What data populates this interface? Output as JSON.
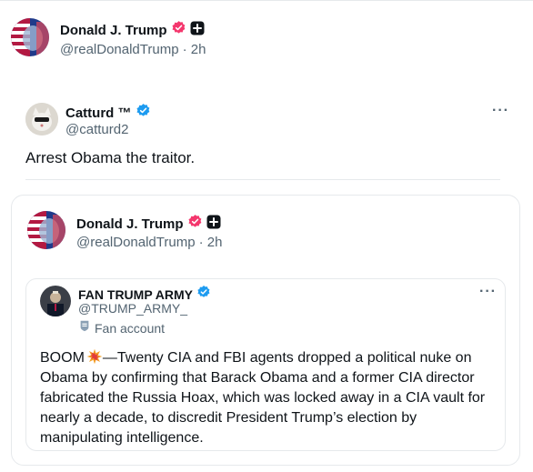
{
  "post": {
    "author_name": "Donald J. Trump",
    "author_handle": "@realDonaldTrump",
    "time": "· 2h"
  },
  "quoted_tweet": {
    "author_name": "Catturd ™",
    "author_handle": "@catturd2",
    "text": "Arrest Obama the traitor.",
    "more_label": "···"
  },
  "nested_quote": {
    "author_name": "Donald J. Trump",
    "author_handle": "@realDonaldTrump",
    "time": "· 2h",
    "inner": {
      "author_name": "FAN TRUMP ARMY",
      "author_handle": "@TRUMP_ARMY_",
      "label": "Fan account",
      "more_label": "···",
      "text_prefix": "BOOM",
      "text": "—Twenty CIA and FBI agents dropped a political nuke on Obama by confirming that Barack Obama and a former CIA director fabricated the Russia Hoax, which was locked away in a CIA vault for nearly a decade, to discredit President Trump’s election by manipulating intelligence."
    }
  },
  "colors": {
    "verified_blue": "#1d9bf0",
    "affiliation_pink": "#f4376d",
    "text_secondary": "#536471",
    "border": "#e6e9ec"
  },
  "icons": [
    "verified-badge-icon",
    "pink-verified-icon",
    "affiliation-plus-icon",
    "more-icon",
    "fan-account-icon",
    "boom-emoji-icon"
  ]
}
